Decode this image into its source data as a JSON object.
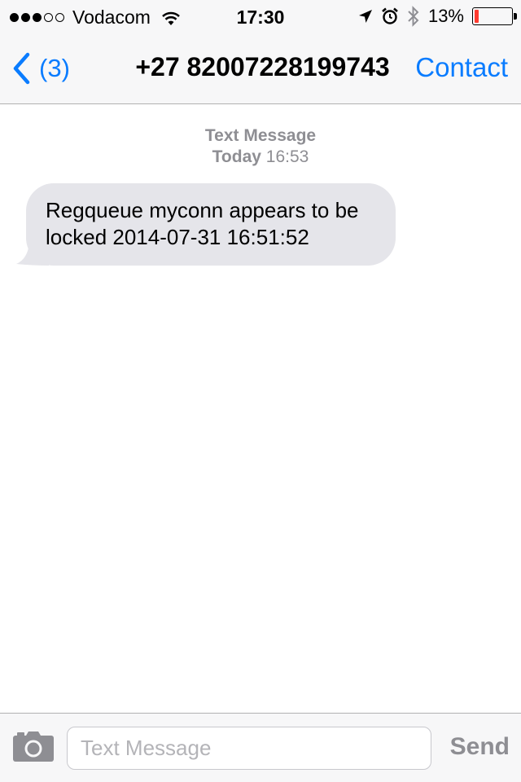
{
  "status_bar": {
    "signal_bars_filled": 3,
    "signal_bars_total": 5,
    "carrier": "Vodacom",
    "time": "17:30",
    "battery_percent": "13%",
    "battery_level": 0.13,
    "battery_color": "#ff3b30",
    "icons": [
      "wifi-icon",
      "location-arrow-icon",
      "alarm-icon",
      "bluetooth-icon",
      "battery-icon"
    ]
  },
  "nav": {
    "back_label": "(3)",
    "title": "+27 82007228199743",
    "contact_label": "Contact",
    "accent_color": "#0a7cff"
  },
  "conversation": {
    "service_label": "Text Message",
    "day": "Today",
    "time": "16:53",
    "messages": [
      {
        "direction": "incoming",
        "text": "Regqueue myconn appears to be locked 2014-07-31 16:51:52"
      }
    ]
  },
  "input_bar": {
    "placeholder": "Text Message",
    "value": "",
    "send_label": "Send"
  }
}
